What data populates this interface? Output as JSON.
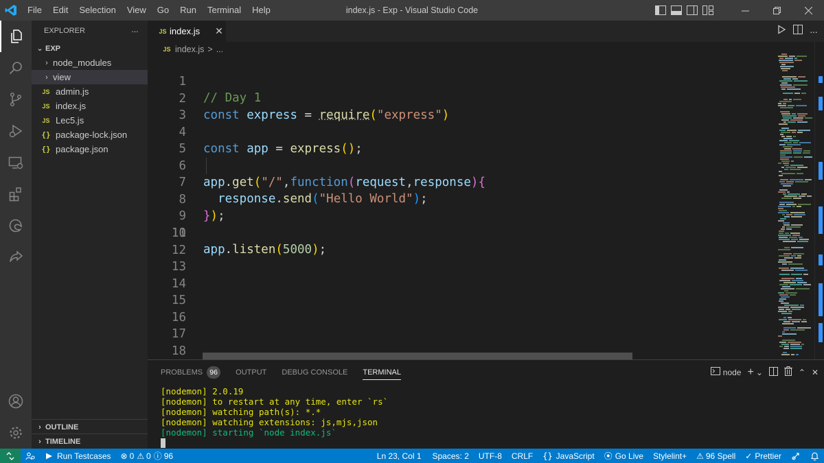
{
  "window": {
    "title": "index.js - Exp - Visual Studio Code",
    "menu": [
      "File",
      "Edit",
      "Selection",
      "View",
      "Go",
      "Run",
      "Terminal",
      "Help"
    ]
  },
  "sidebar": {
    "header": "EXPLORER",
    "more": "···",
    "folder": "EXP",
    "items": [
      {
        "label": "node_modules",
        "kind": "folder"
      },
      {
        "label": "view",
        "kind": "folder"
      },
      {
        "label": "admin.js",
        "kind": "js"
      },
      {
        "label": "index.js",
        "kind": "js"
      },
      {
        "label": "Lec5.js",
        "kind": "js"
      },
      {
        "label": "package-lock.json",
        "kind": "json"
      },
      {
        "label": "package.json",
        "kind": "json"
      }
    ],
    "outline": "OUTLINE",
    "timeline": "TIMELINE"
  },
  "editor": {
    "tab_label": "index.js",
    "file_badge": "JS",
    "json_badge": "{}",
    "breadcrumb_file": "index.js",
    "breadcrumb_sep": ">",
    "breadcrumb_more": "...",
    "line_numbers": [
      "1",
      "2",
      "3",
      "4",
      "5",
      "6",
      "7",
      "8",
      "9",
      "10",
      "11",
      "12",
      "13",
      "14",
      "15",
      "16",
      "17",
      "18"
    ],
    "code": {
      "l1_comment": "// Day 1",
      "l2_const": "const",
      "l2_var": "express",
      "l2_eq": " = ",
      "l2_fn": "require",
      "l2_open": "(",
      "l2_str": "\"express\"",
      "l2_close": ")",
      "l4_const": "const",
      "l4_var": "app",
      "l4_eq": " = ",
      "l4_fn": "express",
      "l4_parens": "()",
      "l4_semi": ";",
      "l6_app": "app",
      "l6_dot": ".",
      "l6_get": "get",
      "l6_open": "(",
      "l6_str": "\"/\"",
      "l6_comma": ",",
      "l6_function": "function",
      "l6_popen": "(",
      "l6_p1": "request",
      "l6_comma2": ",",
      "l6_p2": "response",
      "l6_pclose": ")",
      "l6_brace": "{",
      "l7_indent": "  ",
      "l7_obj": "response",
      "l7_dot": ".",
      "l7_fn": "send",
      "l7_open": "(",
      "l7_str": "\"Hello World\"",
      "l7_close": ")",
      "l7_semi": ";",
      "l8_brace": "}",
      "l8_close": ")",
      "l8_semi": ";",
      "l10_app": "app",
      "l10_dot": ".",
      "l10_fn": "listen",
      "l10_open": "(",
      "l10_num": "5000",
      "l10_close": ")",
      "l10_semi": ";"
    }
  },
  "panel": {
    "tabs": [
      "PROBLEMS",
      "OUTPUT",
      "DEBUG CONSOLE",
      "TERMINAL"
    ],
    "problems_count": "96",
    "terminal_name": "node",
    "terminal_lines": [
      {
        "text": "[nodemon] 2.0.19",
        "color": "yellow"
      },
      {
        "text": "[nodemon] to restart at any time, enter `rs`",
        "color": "yellow"
      },
      {
        "text": "[nodemon] watching path(s): *.*",
        "color": "yellow"
      },
      {
        "text": "[nodemon] watching extensions: js,mjs,json",
        "color": "yellow"
      },
      {
        "text": "[nodemon] starting `node index.js`",
        "color": "green"
      }
    ]
  },
  "statusbar": {
    "run_testcases": "Run Testcases",
    "errors": "0",
    "warnings": "0",
    "info": "96",
    "position": "Ln 23, Col 1",
    "spaces": "Spaces: 2",
    "encoding": "UTF-8",
    "eol": "CRLF",
    "language": "JavaScript",
    "go_live": "Go Live",
    "stylelint": "Stylelint+",
    "spell": "96 Spell",
    "prettier": "Prettier"
  },
  "colors": {
    "accent": "#007acc",
    "remote": "#16825d",
    "js_badge": "#cbcb41",
    "logo": "#23a9f2"
  }
}
